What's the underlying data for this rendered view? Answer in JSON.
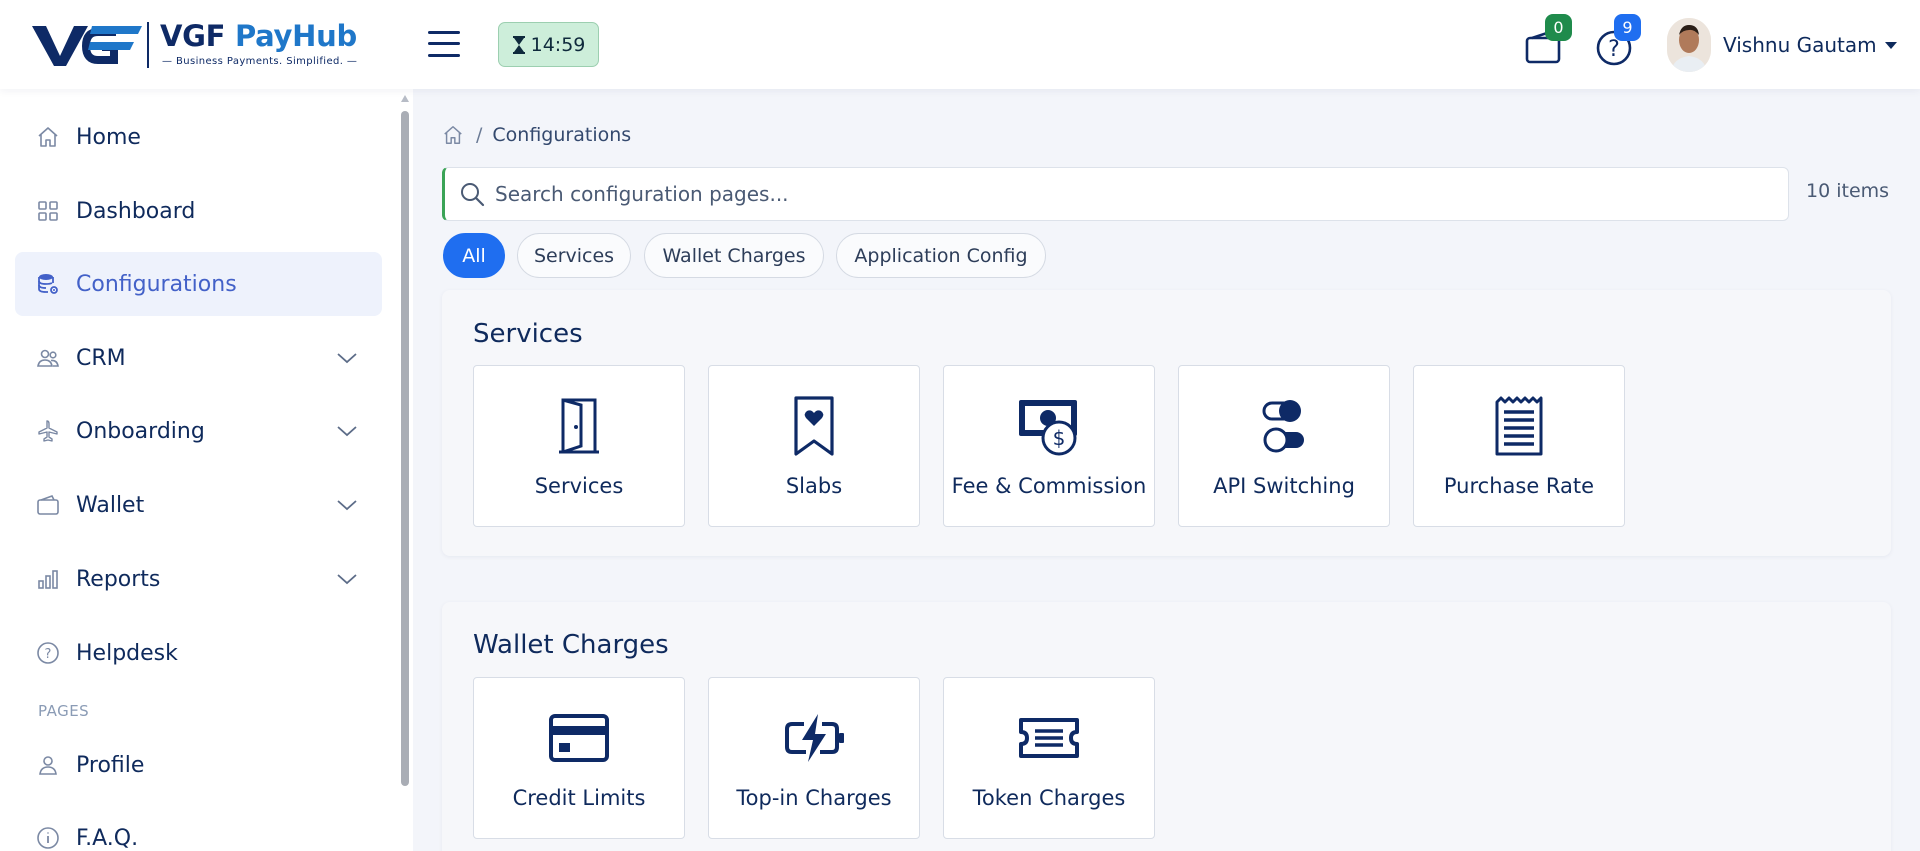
{
  "header": {
    "logo": {
      "brand_primary": "VGF",
      "brand_secondary": "PayHub",
      "tagline": "— Business Payments. Simplified. —"
    },
    "menu_icon": "hamburger-menu-icon",
    "timer": {
      "icon": "hourglass-icon",
      "value": "14:59"
    },
    "wallet": {
      "icon": "wallet-icon",
      "badge": "0"
    },
    "help": {
      "icon": "help-circle-icon",
      "badge": "9"
    },
    "user": {
      "name": "Vishnu Gautam",
      "avatar": "user-avatar"
    }
  },
  "sidebar": {
    "items": [
      {
        "label": "Home",
        "icon": "home-icon",
        "expandable": false,
        "active": false
      },
      {
        "label": "Dashboard",
        "icon": "grid-icon",
        "expandable": false,
        "active": false
      },
      {
        "label": "Configurations",
        "icon": "database-settings-icon",
        "expandable": false,
        "active": true
      },
      {
        "label": "CRM",
        "icon": "users-icon",
        "expandable": true,
        "active": false
      },
      {
        "label": "Onboarding",
        "icon": "airplane-icon",
        "expandable": true,
        "active": false
      },
      {
        "label": "Wallet",
        "icon": "wallet-icon",
        "expandable": true,
        "active": false
      },
      {
        "label": "Reports",
        "icon": "bar-chart-icon",
        "expandable": true,
        "active": false
      },
      {
        "label": "Helpdesk",
        "icon": "help-circle-icon",
        "expandable": false,
        "active": false
      }
    ],
    "pages_heading": "PAGES",
    "pages": [
      {
        "label": "Profile",
        "icon": "user-icon"
      },
      {
        "label": "F.A.Q.",
        "icon": "info-circle-icon"
      }
    ]
  },
  "main": {
    "breadcrumb": {
      "home_icon": "home-icon",
      "separator": "/",
      "current": "Configurations"
    },
    "search": {
      "placeholder": "Search configuration pages...",
      "value": ""
    },
    "item_count": "10 items",
    "filters": [
      {
        "label": "All",
        "active": true
      },
      {
        "label": "Services",
        "active": false
      },
      {
        "label": "Wallet Charges",
        "active": false
      },
      {
        "label": "Application Config",
        "active": false
      }
    ],
    "sections": [
      {
        "title": "Services",
        "tiles": [
          {
            "label": "Services",
            "icon": "door-icon"
          },
          {
            "label": "Slabs",
            "icon": "bookmark-heart-icon"
          },
          {
            "label": "Fee & Commission",
            "icon": "cash-dollar-icon"
          },
          {
            "label": "API Switching",
            "icon": "toggle-switch-icon"
          },
          {
            "label": "Purchase Rate",
            "icon": "receipt-icon"
          }
        ]
      },
      {
        "title": "Wallet Charges",
        "tiles": [
          {
            "label": "Credit Limits",
            "icon": "credit-card-icon"
          },
          {
            "label": "Top-in Charges",
            "icon": "battery-charging-icon"
          },
          {
            "label": "Token Charges",
            "icon": "ticket-icon"
          }
        ]
      }
    ]
  },
  "colors": {
    "primary_navy": "#0f2a5c",
    "accent_blue": "#1f6ef0",
    "active_nav_bg": "#eef2fc",
    "active_nav_text": "#4361c8",
    "badge_green": "#1f8b4c",
    "timer_bg": "#cdeeda",
    "search_accent": "#3aa356"
  }
}
